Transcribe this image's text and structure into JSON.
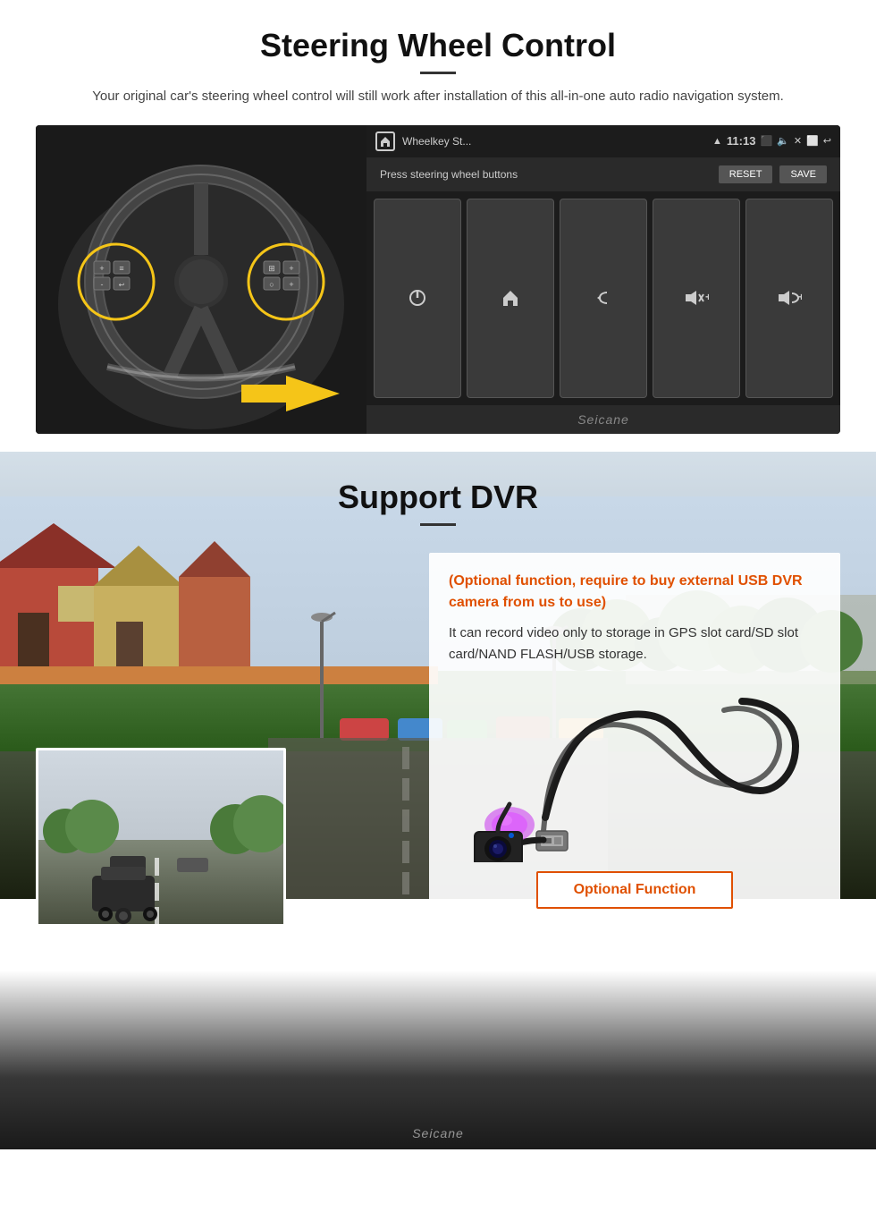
{
  "steering": {
    "title": "Steering Wheel Control",
    "subtitle": "Your original car's steering wheel control will still work after installation of this all-in-one auto radio navigation system.",
    "status_bar": {
      "app_name": "Wheelkey St...",
      "time": "11:13"
    },
    "wheelkey_label": "Press steering wheel buttons",
    "reset_btn": "RESET",
    "save_btn": "SAVE",
    "seicane": "Seicane"
  },
  "dvr": {
    "title": "Support DVR",
    "optional_text": "(Optional function, require to buy external USB DVR camera from us to use)",
    "desc_text": "It can record video only to storage in GPS slot card/SD slot card/NAND FLASH/USB storage.",
    "optional_btn": "Optional Function",
    "seicane": "Seicane"
  }
}
